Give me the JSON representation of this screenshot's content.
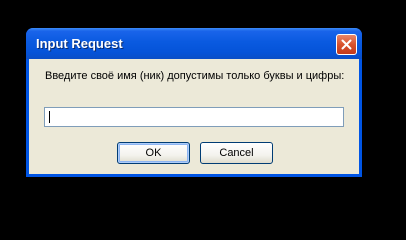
{
  "window": {
    "title": "Input Request",
    "close_icon": "close-icon"
  },
  "dialog": {
    "message": "Введите своё имя (ник) допустимы только буквы и цифры:",
    "input_value": "",
    "ok_label": "OK",
    "cancel_label": "Cancel"
  },
  "colors": {
    "titlebar": "#0a5ae0",
    "client_bg": "#ece9d8",
    "close_button": "#d9522c"
  }
}
